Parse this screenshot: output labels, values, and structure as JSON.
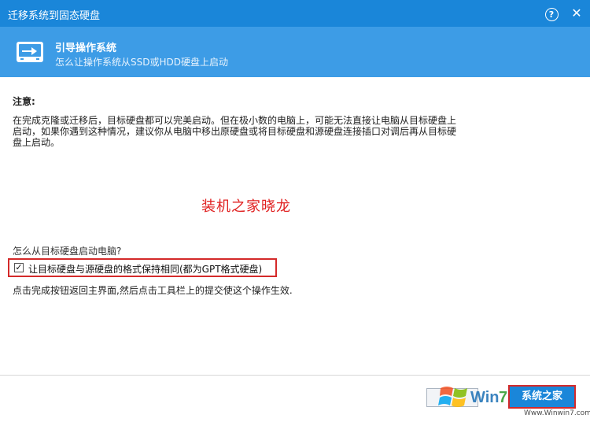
{
  "window": {
    "title": "迁移系统到固态硬盘",
    "help_glyph": "?",
    "close_glyph": "✕"
  },
  "header": {
    "title": "引导操作系统",
    "subtitle": "怎么让操作系统从SSD或HDD硬盘上启动",
    "icon": "disk-icon"
  },
  "content": {
    "note_label": "注意:",
    "note_text": "在完成克隆或迁移后，目标硬盘都可以完美启动。但在极小数的电脑上，可能无法直接让电脑从目标硬盘上启动，如果你遇到这种情况，建议你从电脑中移出原硬盘或将目标硬盘和源硬盘连接插口对调后再从目标硬盘上启动。",
    "watermark": "装机之家晓龙",
    "question": "怎么从目标硬盘启动电脑?",
    "option": {
      "checked": true,
      "check_glyph": "✓",
      "label": "让目标硬盘与源硬盘的格式保持相同(都为GPT格式硬盘)"
    },
    "hint": "点击完成按钮返回主界面,然后点击工具栏上的提交使这个操作生效."
  },
  "footer": {
    "back_label": "",
    "finish_label": "系统之家",
    "logo_text": "Win",
    "logo_url": "Www.Winwin7.com"
  },
  "colors": {
    "titlebar": "#1a86d9",
    "header": "#3d9ce6",
    "highlight": "#d42a2a",
    "watermark": "#e02020"
  }
}
